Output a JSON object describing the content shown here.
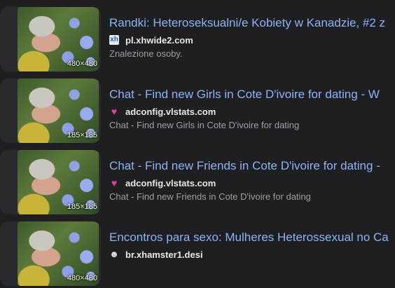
{
  "results": [
    {
      "title": "Randki: Heteroseksualni/e Kobiety w Kanadzie, #2 z",
      "domain": "pl.xhwide2.com",
      "favicon": "xh-square-icon",
      "snippet": "Znalezione osoby.",
      "resolution": "480×480"
    },
    {
      "title": "Chat - Find new Girls in Cote D'ivoire for dating - W",
      "domain": "adconfig.vlstats.com",
      "favicon": "heart-icon",
      "snippet": "Chat - Find new Girls in Cote D'ivoire for dating",
      "resolution": "185×185"
    },
    {
      "title": "Chat - Find new Friends in Cote D'ivoire for dating -",
      "domain": "adconfig.vlstats.com",
      "favicon": "heart-icon",
      "snippet": "Chat - Find new Friends in Cote D'ivoire for dating",
      "resolution": "185×185"
    },
    {
      "title": "Encontros para sexo: Mulheres Heterossexual no Ca",
      "domain": "br.xhamster1.desi",
      "favicon": "hamster-icon",
      "snippet": "",
      "resolution": "480×480"
    }
  ]
}
